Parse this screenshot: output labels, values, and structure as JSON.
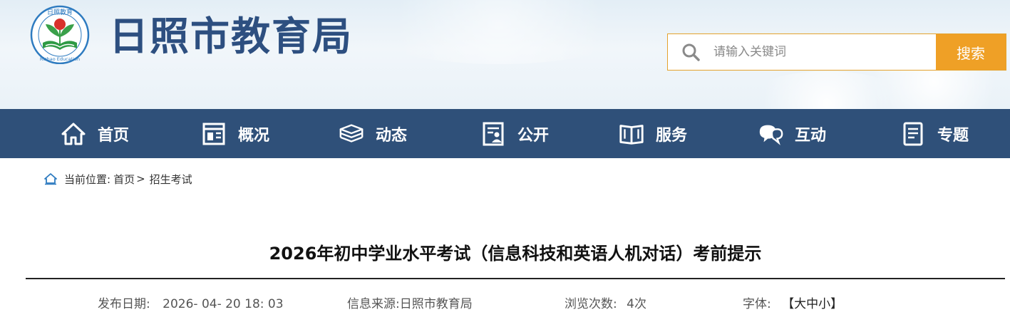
{
  "header": {
    "site_title": "日照市教育局",
    "logo_text_top": "日照教育",
    "logo_text_bottom": "Rizhao Education"
  },
  "search": {
    "placeholder": "请输入关键词",
    "button_label": "搜索"
  },
  "nav": {
    "items": [
      {
        "label": "首页",
        "icon": "home-icon"
      },
      {
        "label": "概况",
        "icon": "overview-icon"
      },
      {
        "label": "动态",
        "icon": "news-stack-icon"
      },
      {
        "label": "公开",
        "icon": "disclosure-icon"
      },
      {
        "label": "服务",
        "icon": "book-icon"
      },
      {
        "label": "互动",
        "icon": "chat-icon"
      },
      {
        "label": "专题",
        "icon": "document-icon"
      }
    ]
  },
  "breadcrumb": {
    "prefix": "当前位置:",
    "home": "首页",
    "separator": ">",
    "current": "招生考试"
  },
  "article": {
    "title": "2026年初中学业水平考试（信息科技和英语人机对话）考前提示",
    "publish_label": "发布日期:",
    "publish_date": "2026- 04- 20 18: 03",
    "source_label": "信息来源:",
    "source": "日照市教育局",
    "views_label": "浏览次数:",
    "views": "4次",
    "font_label": "字体:",
    "font_open": "【",
    "font_large": "大",
    "font_medium": "中",
    "font_small": "小",
    "font_close": "】"
  },
  "colors": {
    "nav_bg": "#2f5079",
    "title_blue": "#2d4f80",
    "search_orange": "#efa026",
    "logo_green": "#3aa04a",
    "logo_red": "#d8312b"
  }
}
